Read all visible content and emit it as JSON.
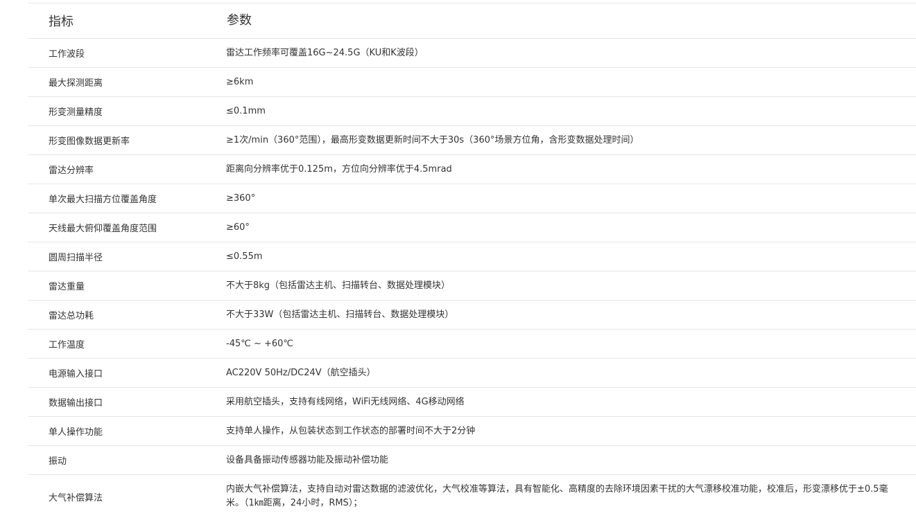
{
  "header": {
    "key_label": "指标",
    "value_label": "参数"
  },
  "rows": [
    {
      "key": "工作波段",
      "value": "雷达工作频率可覆盖16G~24.5G（KU和K波段）"
    },
    {
      "key": "最大探测距离",
      "value": "≥6km"
    },
    {
      "key": "形变测量精度",
      "value": "≤0.1mm"
    },
    {
      "key": "形变图像数据更新率",
      "value": "≥1次/min（360°范围），最高形变数据更新时间不大于30s（360°场景方位角，含形变数据处理时间）"
    },
    {
      "key": "雷达分辨率",
      "value": "距离向分辨率优于0.125m，方位向分辨率优于4.5mrad"
    },
    {
      "key": "单次最大扫描方位覆盖角度",
      "value": "≥360°"
    },
    {
      "key": "天线最大俯仰覆盖角度范围",
      "value": "≥60°"
    },
    {
      "key": "圆周扫描半径",
      "value": "≤0.55m"
    },
    {
      "key": "雷达重量",
      "value": "不大于8kg（包括雷达主机、扫描转台、数据处理模块）"
    },
    {
      "key": "雷达总功耗",
      "value": "不大于33W（包括雷达主机、扫描转台、数据处理模块）"
    },
    {
      "key": "工作温度",
      "value": "-45℃ ~ +60℃"
    },
    {
      "key": "电源输入接口",
      "value": "AC220V 50Hz/DC24V（航空插头）"
    },
    {
      "key": "数据输出接口",
      "value": "采用航空插头，支持有线网络，WiFi无线网络、4G移动网络"
    },
    {
      "key": "单人操作功能",
      "value": "支持单人操作，从包装状态到工作状态的部署时间不大于2分钟"
    },
    {
      "key": "振动",
      "value": "设备具备振动传感器功能及振动补偿功能"
    },
    {
      "key": "大气补偿算法",
      "value": "内嵌大气补偿算法，支持自动对雷达数据的滤波优化，大气校准等算法，具有智能化、高精度的去除环境因素干扰的大气漂移校准功能，校准后，形变漂移优于±0.5毫米。（1㎞距离，24小时，RMS）；"
    }
  ]
}
